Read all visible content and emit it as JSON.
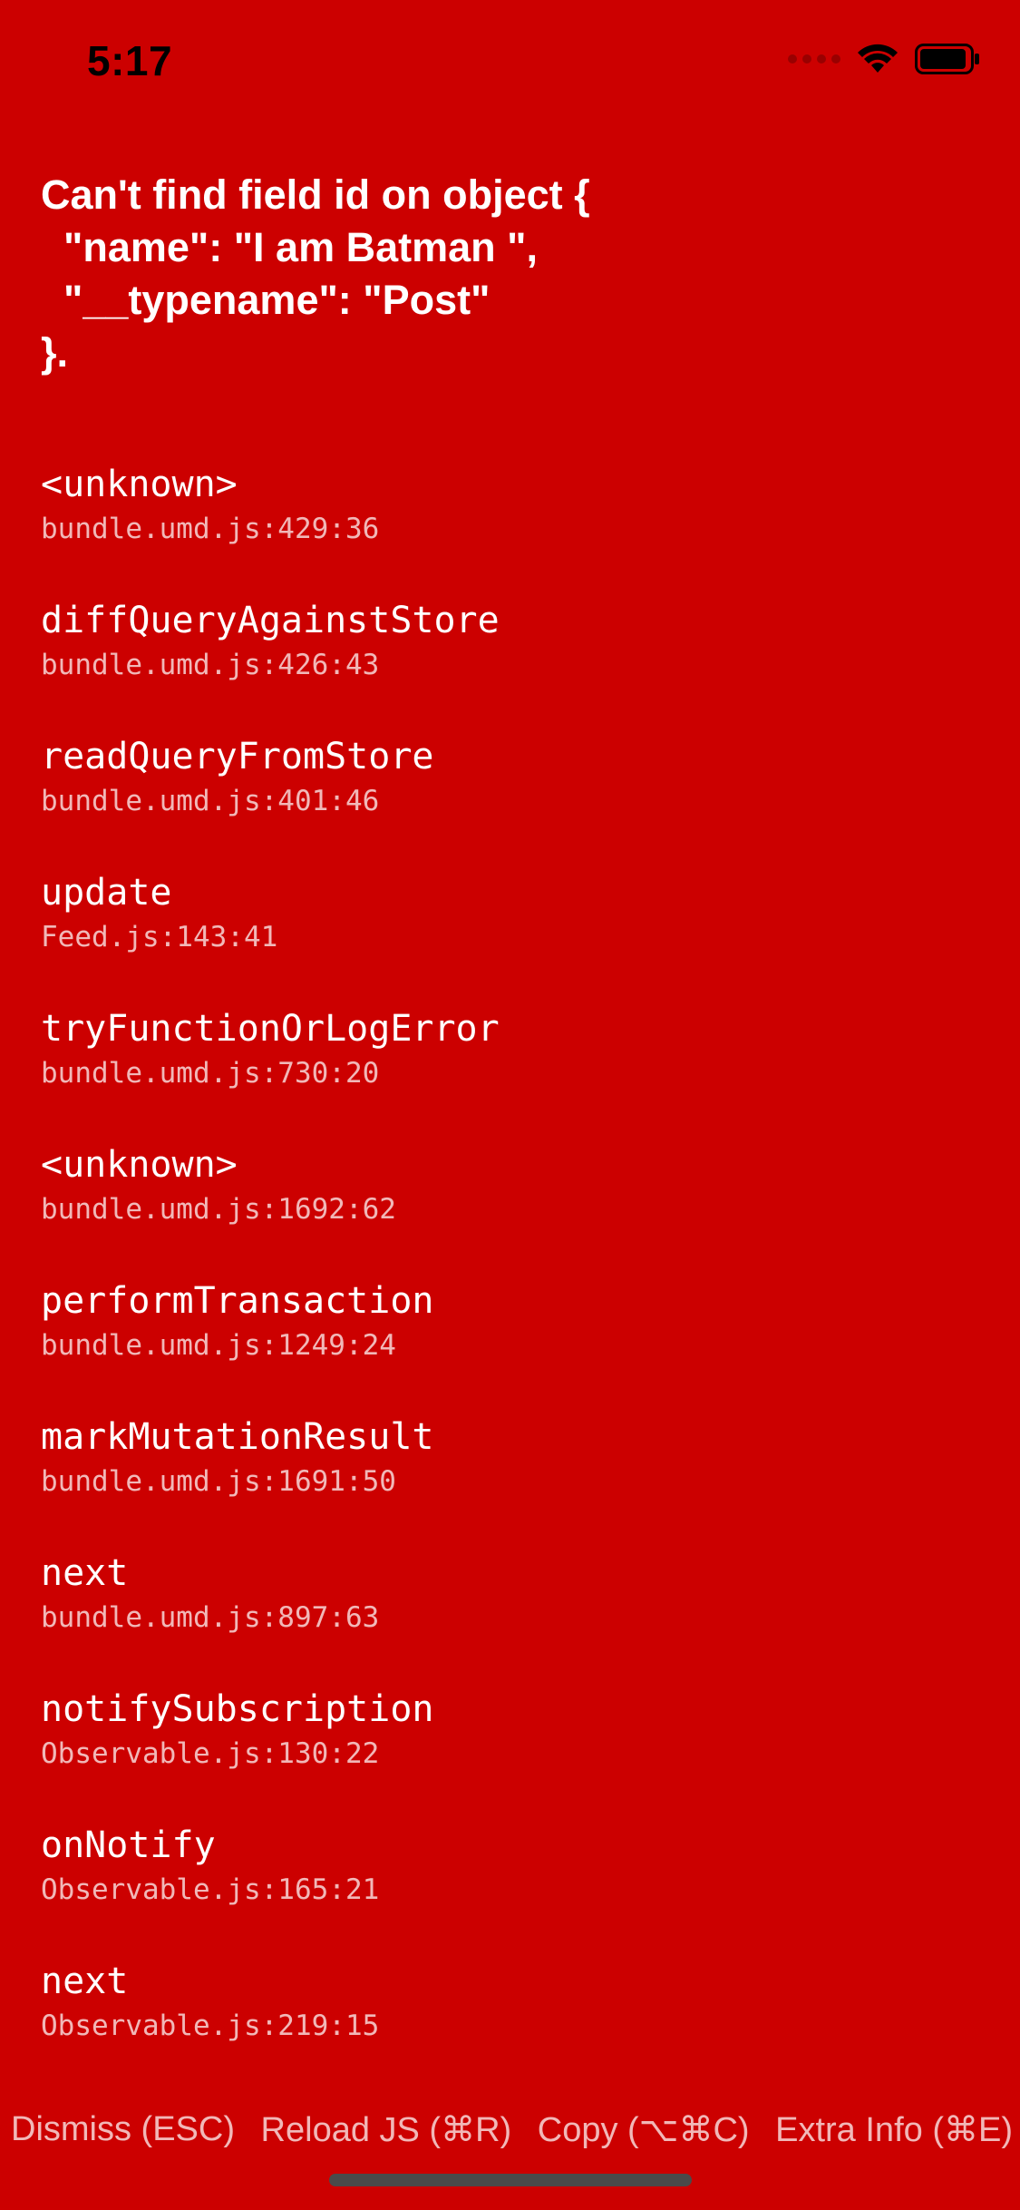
{
  "status_bar": {
    "time": "5:17",
    "icons": [
      "signal-icon",
      "wifi-icon",
      "battery-icon"
    ]
  },
  "error": {
    "message": "Can't find field id on object {\n  \"name\": \"I am Batman \",\n  \"__typename\": \"Post\"\n}."
  },
  "stack": [
    {
      "method": "<unknown>",
      "location": "bundle.umd.js:429:36"
    },
    {
      "method": "diffQueryAgainstStore",
      "location": "bundle.umd.js:426:43"
    },
    {
      "method": "readQueryFromStore",
      "location": "bundle.umd.js:401:46"
    },
    {
      "method": "update",
      "location": "Feed.js:143:41"
    },
    {
      "method": "tryFunctionOrLogError",
      "location": "bundle.umd.js:730:20"
    },
    {
      "method": "<unknown>",
      "location": "bundle.umd.js:1692:62"
    },
    {
      "method": "performTransaction",
      "location": "bundle.umd.js:1249:24"
    },
    {
      "method": "markMutationResult",
      "location": "bundle.umd.js:1691:50"
    },
    {
      "method": "next",
      "location": "bundle.umd.js:897:63"
    },
    {
      "method": "notifySubscription",
      "location": "Observable.js:130:22"
    },
    {
      "method": "onNotify",
      "location": "Observable.js:165:21"
    },
    {
      "method": "next",
      "location": "Observable.js:219:15"
    }
  ],
  "footer": {
    "dismiss": "Dismiss (ESC)",
    "reload": "Reload JS (⌘R)",
    "copy": "Copy (⌥⌘C)",
    "extra_info": "Extra Info (⌘E)"
  },
  "colors": {
    "background": "#CC0000",
    "text": "#FFFFFF",
    "muted_text": "#F0B8B8",
    "status_text": "#000000"
  }
}
